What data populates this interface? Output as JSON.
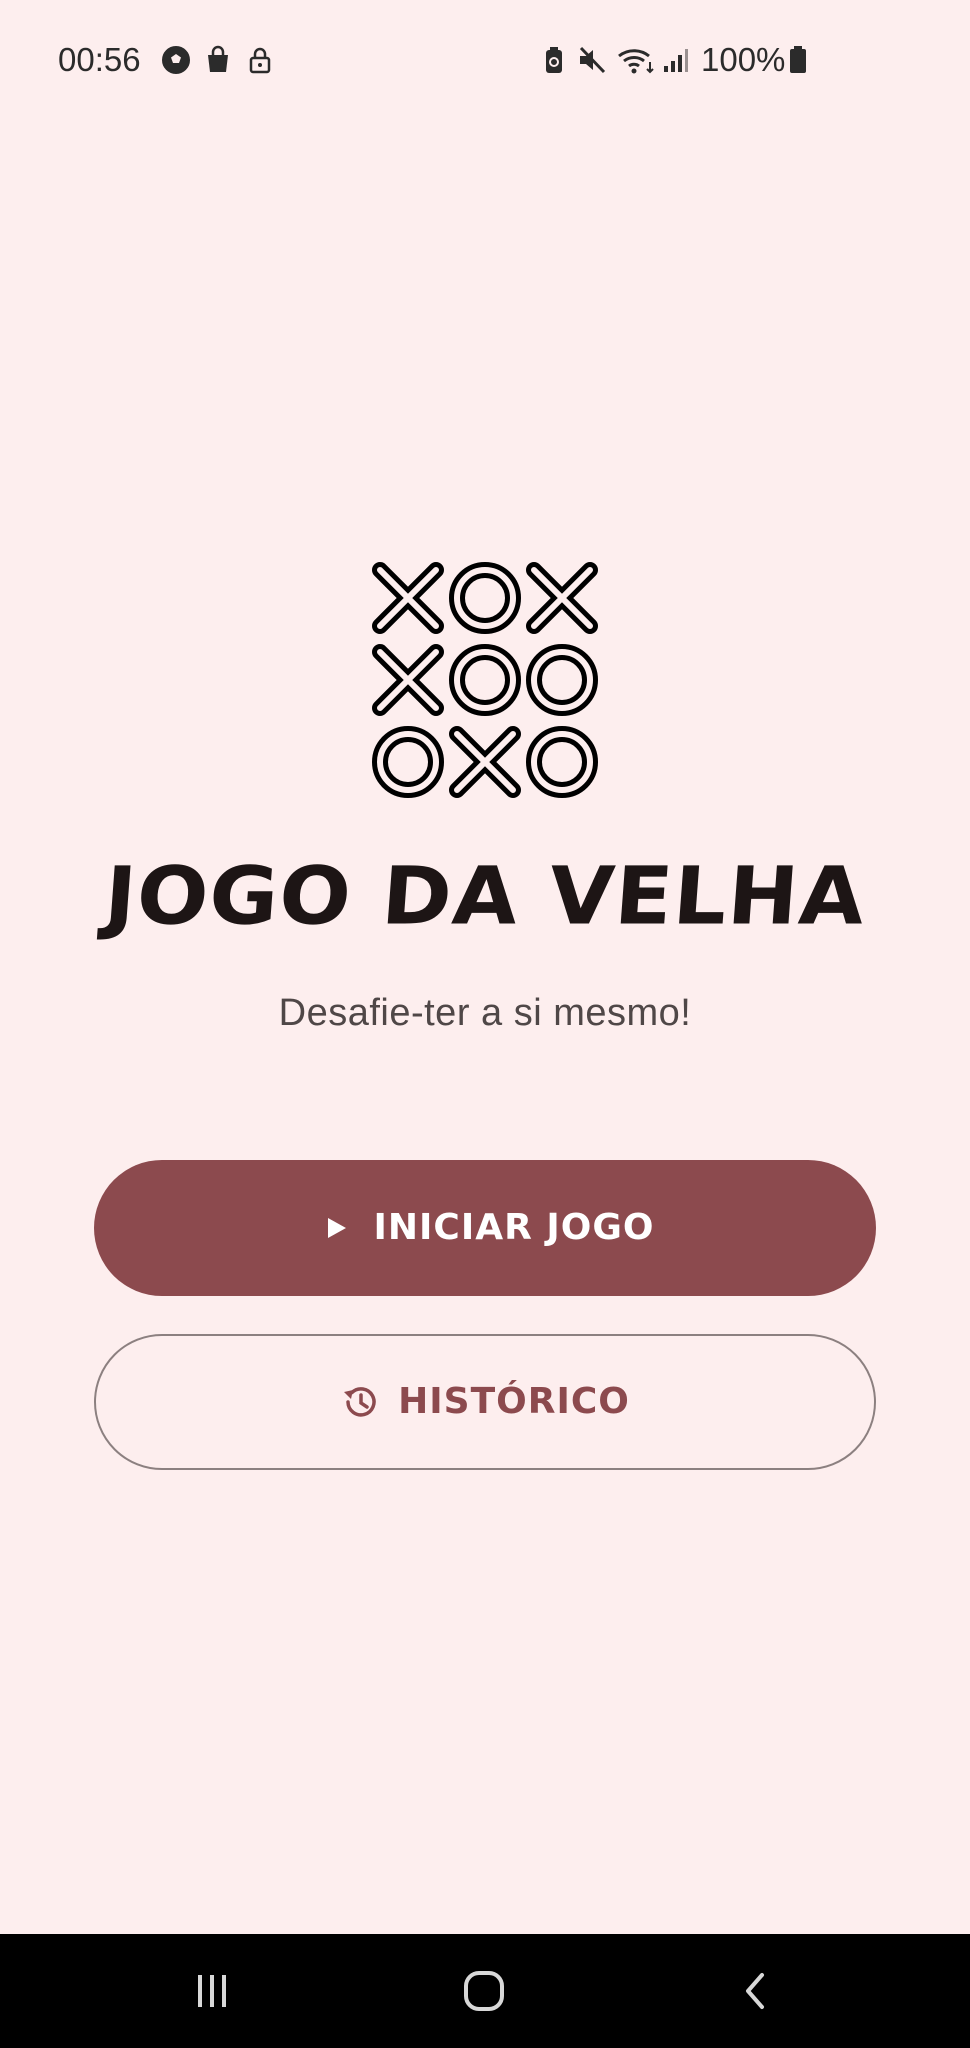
{
  "status_bar": {
    "time": "00:56",
    "battery_text": "100%",
    "icons_left": [
      "soccer-ball-icon",
      "shopping-bag-icon",
      "lock-icon"
    ],
    "icons_right": [
      "battery-saver-icon",
      "mute-icon",
      "wifi-icon",
      "signal-icon",
      "battery-icon"
    ]
  },
  "app": {
    "title": "JOGO DA VELHA",
    "subtitle": "Desafie-ter a si mesmo!",
    "logo_grid": [
      "XOX",
      "XOO",
      "OXO"
    ]
  },
  "buttons": {
    "start_label": "INICIAR JOGO",
    "start_icon": "play-icon",
    "history_label": "HISTÓRICO",
    "history_icon": "history-icon"
  },
  "nav": {
    "items": [
      "recents-icon",
      "home-icon",
      "back-icon"
    ]
  },
  "colors": {
    "background": "#fdeeee",
    "primary": "#8c4a4e",
    "title": "#1d1515",
    "subtitle": "#4f4747"
  }
}
